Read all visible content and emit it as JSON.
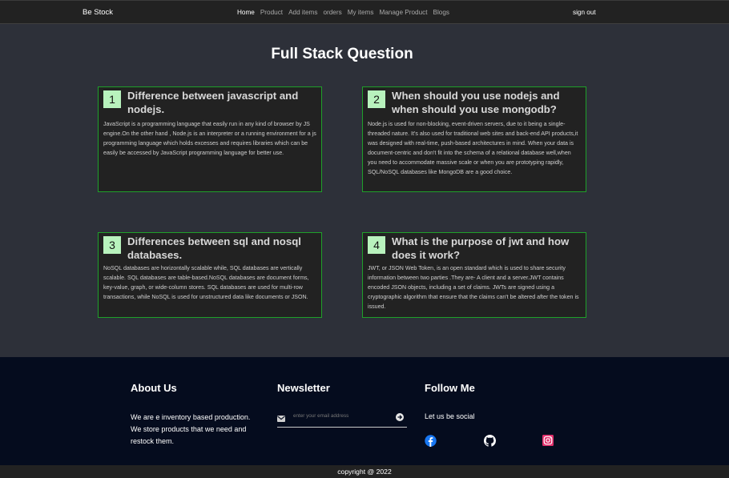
{
  "navbar": {
    "brand": "Be Stock",
    "links": [
      "Home",
      "Product",
      "Add items",
      "orders",
      "My items",
      "Manage Product",
      "Blogs"
    ],
    "active": "Home",
    "signout": "sign out"
  },
  "main": {
    "title": "Full Stack Question",
    "cards": [
      {
        "number": "1",
        "question": "Difference between javascript and nodejs.",
        "answer": "JavaScript is a programming language that easily run in any kind of browser by JS engine.On the other hand , Node.js is an interpreter or a running environment for a js programming language which holds excesses and requires libraries which can be easily be accessed by JavaScript programming language for better use."
      },
      {
        "number": "2",
        "question": "When should you use nodejs and when should you use mongodb?",
        "answer": "Node.js is used for non-blocking, event-driven servers, due to it being a single-threaded nature. It's also used for traditional web sites and back-end API products,it was designed with real-time, push-based architectures in mind. When your data is document-centric and don't fit into the schema of a relational database well,when you need to accommodate massive scale or when you are prototyping rapidly, SQL/NoSQL databases like MongoDB are a good choice."
      },
      {
        "number": "3",
        "question": "Differences between sql and nosql databases.",
        "answer": "NoSQL databases are horizontally scalable while, SQL databases are vertically scalable. SQL databases are table-based.NoSQL databases are document forms, key-value, graph, or wide-column stores. SQL databases are used for multi-row transactions, while NoSQL is used for unstructured data like documents or JSON."
      },
      {
        "number": "4",
        "question": "What is the purpose of jwt and how does it work?",
        "answer": "JWT, or JSON Web Token, is an open standard which is used to share security information between two parties .They are- A client and a server.JWT contains encoded JSON objects, including a set of claims. JWTs are signed using a cryptographic algorithm that ensure that the claims can't be altered after the token is issued."
      }
    ]
  },
  "footer": {
    "about": {
      "heading": "About Us",
      "text": "We are e inventory based production. We store products that we need and restock them."
    },
    "newsletter": {
      "heading": "Newsletter",
      "placeholder": "enter your email address"
    },
    "follow": {
      "heading": "Follow Me",
      "text": "Let us be social",
      "icons": [
        "facebook-icon",
        "github-icon",
        "instagram-icon"
      ]
    },
    "copyright": "copyright @ 2022"
  },
  "colors": {
    "navbar_bg": "#222222",
    "page_bg": "#2d3039",
    "card_bg": "#222222",
    "card_border": "#1fa02a",
    "number_badge": "#b8f2bd",
    "footer_bg": "#050c1e",
    "facebook": "#1877f2",
    "instagram": "#e1306c"
  }
}
